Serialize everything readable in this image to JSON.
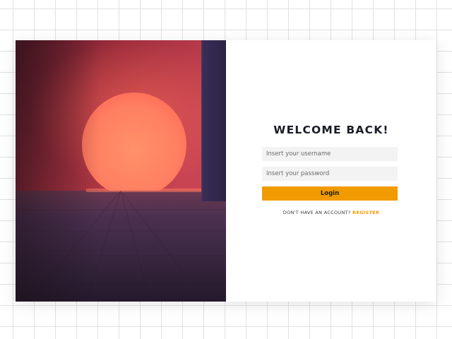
{
  "login": {
    "title": "WELCOME BACK!",
    "username_placeholder": "Insert your username",
    "password_placeholder": "Insert your password",
    "button_label": "Login",
    "account_prompt": "DON'T HAVE AN ACCOUNT?",
    "register_label": "REGISTER"
  },
  "colors": {
    "accent": "#f09b00",
    "title_text": "#1a1c25",
    "field_background": "#f3f3f3"
  },
  "hero_image": {
    "subject": "glowing-sunset-orb-in-dark-room"
  }
}
